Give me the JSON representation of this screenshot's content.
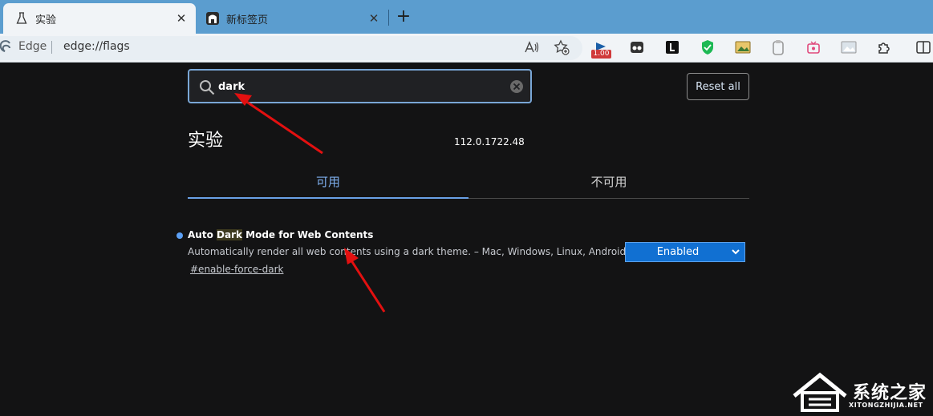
{
  "browser": {
    "tabs": [
      {
        "title": "实验",
        "icon": "flask-icon",
        "active": true
      },
      {
        "title": "新标签页",
        "icon": "newtab-page-icon",
        "active": false
      }
    ],
    "address": {
      "site_label": "Edge",
      "url": "edge://flags"
    },
    "extension_badge": "1.00"
  },
  "flags_page": {
    "search": {
      "value": "dark"
    },
    "reset_label": "Reset all",
    "title": "实验",
    "version": "112.0.1722.48",
    "tabs": {
      "available": "可用",
      "unavailable": "不可用"
    },
    "flag": {
      "name_prefix": "Auto ",
      "name_match": "Dark",
      "name_suffix": " Mode for Web Contents",
      "description": "Automatically render all web contents using a dark theme. – Mac, Windows, Linux, Android",
      "link": "#enable-force-dark",
      "selected": "Enabled"
    }
  },
  "watermark": {
    "text": "系统之家",
    "url": "XITONGZHIJIA.NET"
  },
  "colors": {
    "accent": "#1170d2",
    "tab_active": "#7fb0ef",
    "arrow": "#e31010"
  }
}
